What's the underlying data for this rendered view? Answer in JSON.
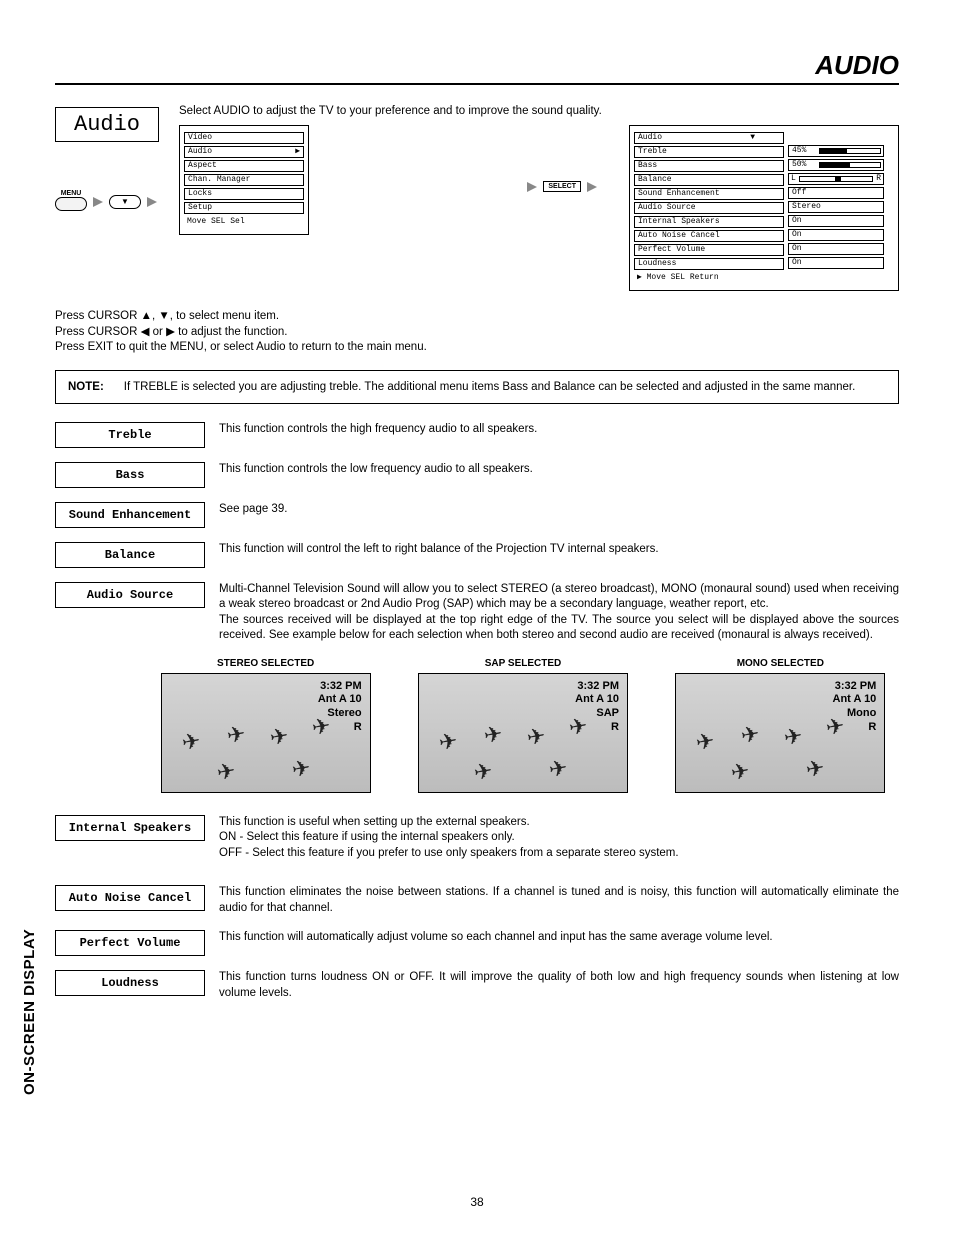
{
  "header": {
    "title": "AUDIO"
  },
  "intro": "Select AUDIO to adjust the TV to your preference and to improve the sound quality.",
  "audio_button": "Audio",
  "remote": {
    "menu_label": "MENU",
    "select_label": "SELECT"
  },
  "main_menu": {
    "items": [
      "Video",
      "Audio",
      "Aspect",
      "Chan. Manager",
      "Locks",
      "Setup"
    ],
    "footer": "Move  SEL  Sel"
  },
  "audio_menu": {
    "title_row": "Audio",
    "items": [
      "Treble",
      "Bass",
      "Balance",
      "Sound Enhancement",
      "Audio Source",
      "Internal Speakers",
      "Auto Noise Cancel",
      "Perfect Volume",
      "Loudness"
    ],
    "values": {
      "treble_label": "45%",
      "treble_pct": 45,
      "bass_label": "50%",
      "bass_pct": 50,
      "balance_left": "L",
      "balance_right": "R",
      "balance_pct": 52,
      "sound_enhancement": "Off",
      "audio_source": "Stereo",
      "internal_speakers": "On",
      "auto_noise_cancel": "On",
      "perfect_volume": "On",
      "loudness": "On"
    },
    "footer": "▶ Move    SEL  Return"
  },
  "instructions": {
    "l1": "Press CURSOR ▲, ▼, to select menu item.",
    "l2": "Press CURSOR ◀ or ▶ to adjust the function.",
    "l3": "Press EXIT to quit the MENU, or select Audio to return to the main menu."
  },
  "note": {
    "label": "NOTE:",
    "text": "If TREBLE is selected you are adjusting treble.  The additional menu items Bass and Balance can be selected and adjusted in the same manner."
  },
  "defs": {
    "treble": {
      "label": "Treble",
      "text": "This function controls the high frequency audio to all speakers."
    },
    "bass": {
      "label": "Bass",
      "text": "This function controls the low frequency audio to all speakers."
    },
    "sound_enh": {
      "label": "Sound Enhancement",
      "text": "See page 39."
    },
    "balance": {
      "label": "Balance",
      "text": "This function will control the left to right balance of the Projection TV internal speakers."
    },
    "audio_source": {
      "label": "Audio Source",
      "text": "Multi-Channel Television Sound will allow you to select STEREO (a stereo broadcast), MONO (monaural sound) used when receiving a weak stereo broadcast or 2nd Audio Prog (SAP) which may be a secondary language, weather report, etc.\nThe sources received will be displayed at the top right edge of the TV.  The source you select will be displayed above the sources received.  See example below for each selection when both stereo and second audio are received (monaural is always received)."
    },
    "internal": {
      "label": "Internal Speakers",
      "text": "This function is useful when setting up the external speakers.\nON - Select this feature if using the internal speakers only.\nOFF - Select this feature if you prefer to use only speakers from a separate stereo system."
    },
    "anc": {
      "label": "Auto Noise Cancel",
      "text": "This function eliminates the noise between stations. If a channel is tuned and is noisy, this function will automatically eliminate the audio for that channel."
    },
    "perfect": {
      "label": "Perfect Volume",
      "text": "This function will automatically adjust volume so each channel  and input has the same average volume level."
    },
    "loudness": {
      "label": "Loudness",
      "text": "This function turns loudness ON or OFF.  It will improve the quality of both low and high frequency sounds when listening at low volume levels."
    }
  },
  "screens": {
    "stereo": {
      "title": "STEREO SELECTED",
      "time": "3:32 PM",
      "ant": "Ant A 10",
      "mode": "Stereo",
      "r": "R"
    },
    "sap": {
      "title": "SAP SELECTED",
      "time": "3:32 PM",
      "ant": "Ant A 10",
      "mode": "SAP",
      "r": "R"
    },
    "mono": {
      "title": "MONO SELECTED",
      "time": "3:32 PM",
      "ant": "Ant A 10",
      "mode": "Mono",
      "r": "R"
    }
  },
  "side_label": "ON-SCREEN DISPLAY",
  "page_number": "38"
}
